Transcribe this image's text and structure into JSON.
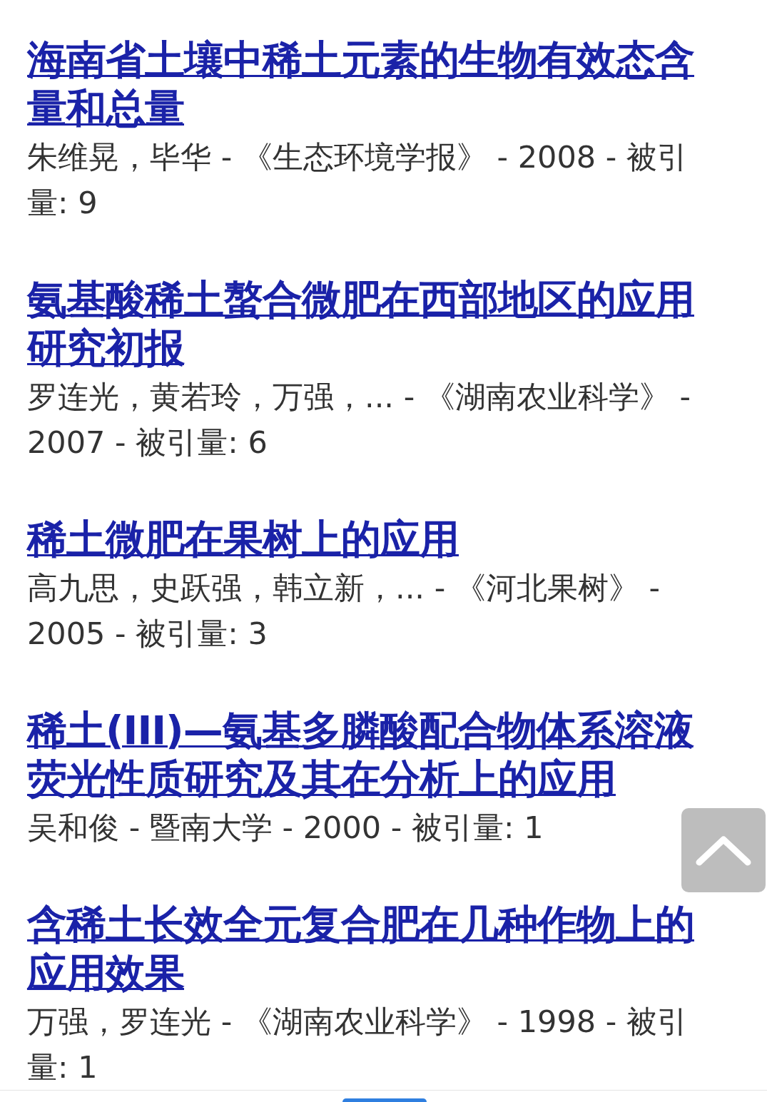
{
  "results": [
    {
      "title": "海南省土壤中稀土元素的生物有效态含量和总量",
      "meta": "朱维晃，毕华 - 《生态环境学报》 - 2008 - 被引量: 9"
    },
    {
      "title": "氨基酸稀土螯合微肥在西部地区的应用研究初报",
      "meta": "罗连光，黄若玲，万强，... - 《湖南农业科学》 - 2007 - 被引量: 6"
    },
    {
      "title": "稀土微肥在果树上的应用",
      "meta": "高九思，史跃强，韩立新，... - 《河北果树》 - 2005 - 被引量: 3"
    },
    {
      "title": "稀土(III)—氨基多膦酸配合物体系溶液荧光性质研究及其在分析上的应用",
      "meta": "吴和俊 - 暨南大学 - 2000 - 被引量: 1"
    },
    {
      "title": "含稀土长效全元复合肥在几种作物上的应用效果",
      "meta": "万强，罗连光 - 《湖南农业科学》 - 1998 - 被引量: 1"
    }
  ]
}
